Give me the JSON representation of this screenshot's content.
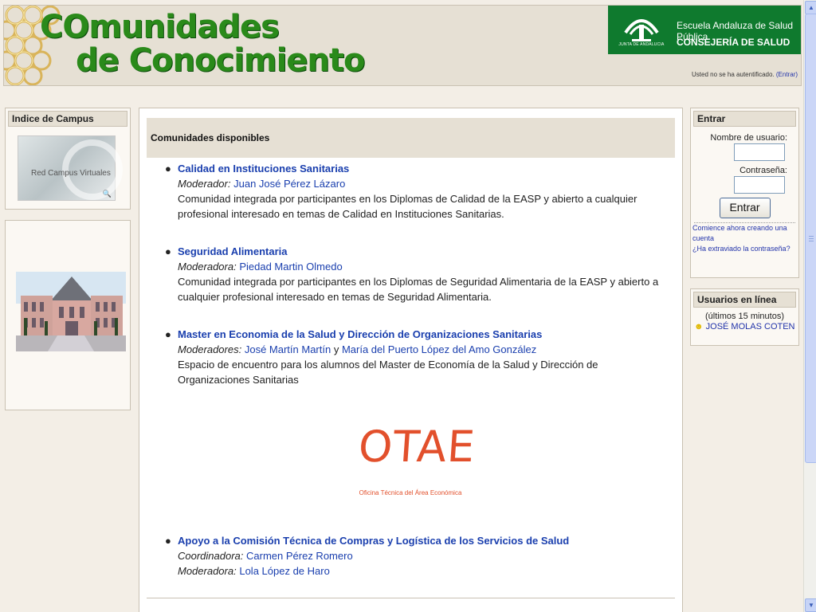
{
  "header": {
    "title_line1": "COmunidades",
    "title_line2": "de Conocimiento",
    "org_line1": "Escuela Andaluza de Salud Pública",
    "org_line2": "CONSEJERÍA DE SALUD",
    "org_logo_caption": "JUNTA DE ANDALUCIA",
    "auth_text": "Usted no se ha autentificado.",
    "auth_link": "(Entrar)"
  },
  "left": {
    "index_title": "Indice de Campus",
    "campus_image_text": "Red Campus Virtuales"
  },
  "main": {
    "heading": "Comunidades disponibles",
    "communities": [
      {
        "name": "Calidad en Instituciones Sanitarias",
        "role1": "Moderador:",
        "person1": "Juan José Pérez Lázaro",
        "description": "Comunidad integrada por participantes en los Diplomas de Calidad de la EASP y abierto a cualquier profesional interesado en temas de Calidad en Instituciones Sanitarias."
      },
      {
        "name": "Seguridad Alimentaria",
        "role1": "Moderadora:",
        "person1": "Piedad Martin Olmedo",
        "description": "Comunidad integrada por participantes en los Diplomas de Seguridad Alimentaria de la EASP y abierto a cualquier profesional interesado en temas de Seguridad Alimentaria."
      },
      {
        "name": "Master en Economia de la Salud y Dirección de Organizaciones Sanitarias",
        "role1": "Moderadores:",
        "person1": "José Martín Martín",
        "conj": "y",
        "person2": "María del Puerto López del Amo González",
        "description": "Espacio de encuentro para los alumnos del Master de Economía de la Salud y Dirección de Organizaciones Sanitarias"
      },
      {
        "name": "Apoyo a la Comisión Técnica de Compras y Logística de los Servicios de Salud",
        "role1": "Coordinadora:",
        "person1": "Carmen Pérez Romero",
        "role2": "Moderadora:",
        "person2": "Lola López de Haro"
      }
    ],
    "otae_logo": "OTAE",
    "otae_caption": "Oficina Técnica del Área Económica"
  },
  "login": {
    "title": "Entrar",
    "username_label": "Nombre de usuario:",
    "password_label": "Contraseña:",
    "button": "Entrar",
    "create_account": "Comience ahora creando una cuenta",
    "forgot": "¿Ha extraviado la contraseña?"
  },
  "online": {
    "title": "Usuarios en línea",
    "period": "(últimos 15 minutos)",
    "user": "JOSÉ MOLAS COTEN"
  }
}
